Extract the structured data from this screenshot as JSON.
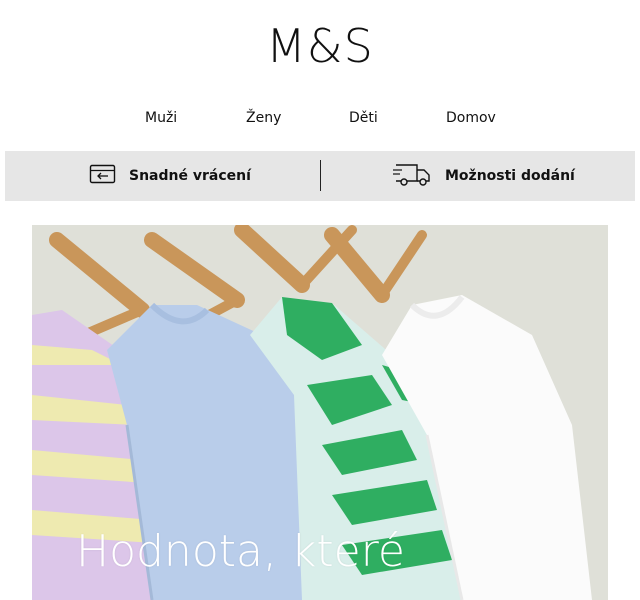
{
  "brand": {
    "logo": "M&S"
  },
  "nav": {
    "items": [
      "Muži",
      "Ženy",
      "Děti",
      "Domov"
    ]
  },
  "services": {
    "returns": {
      "label": "Snadné vrácení",
      "icon": "return-card-icon"
    },
    "delivery": {
      "label": "Možnosti dodání",
      "icon": "delivery-truck-icon"
    }
  },
  "hero": {
    "headline": "Hodnota, které",
    "image": "pastel-tshirts-on-wooden-hangers",
    "colors": {
      "background": "#dfe0d8",
      "lilac": "#dcc6e9",
      "stripe": "#eeeab0",
      "blue": "#b9cdea",
      "green": "#2fae61",
      "white": "#fbfbfb"
    }
  }
}
